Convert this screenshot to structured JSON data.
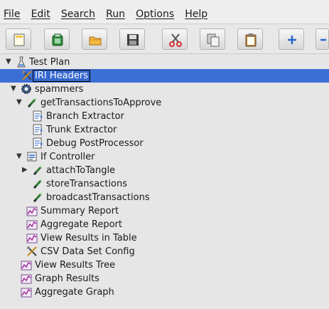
{
  "menu": [
    "File",
    "Edit",
    "Search",
    "Run",
    "Options",
    "Help"
  ],
  "toolbar": {
    "buttons": [
      {
        "name": "new-plan-button",
        "icon": "new-document-icon"
      },
      {
        "name": "templates-button",
        "icon": "templates-icon"
      },
      {
        "name": "open-button",
        "icon": "folder-icon"
      },
      {
        "name": "save-button",
        "icon": "floppy-disk-icon"
      },
      {
        "name": "cut-button",
        "icon": "scissors-icon"
      },
      {
        "name": "copy-button",
        "icon": "copy-icon"
      },
      {
        "name": "paste-button",
        "icon": "clipboard-icon"
      },
      {
        "name": "expand-button",
        "icon": "plus-icon"
      },
      {
        "name": "collapse-button",
        "icon": "minus-icon"
      }
    ]
  },
  "tree": {
    "nodes": [
      {
        "label": "Test Plan",
        "icon": "testplan-icon",
        "toggle": "expanded"
      },
      {
        "label": "IRI Headers",
        "icon": "config-icon",
        "toggle": "",
        "selected": true
      },
      {
        "label": "spammers",
        "icon": "gear-icon",
        "toggle": "expanded"
      },
      {
        "label": "getTransactionsToApprove",
        "icon": "sampler-icon",
        "toggle": "expanded"
      },
      {
        "label": "Branch Extractor",
        "icon": "extractor-icon",
        "toggle": ""
      },
      {
        "label": "Trunk Extractor",
        "icon": "extractor-icon",
        "toggle": ""
      },
      {
        "label": "Debug PostProcessor",
        "icon": "extractor-icon",
        "toggle": ""
      },
      {
        "label": "If Controller",
        "icon": "controller-icon",
        "toggle": "expanded"
      },
      {
        "label": "attachToTangle",
        "icon": "sampler-icon",
        "toggle": "collapsed"
      },
      {
        "label": "storeTransactions",
        "icon": "sampler-icon",
        "toggle": ""
      },
      {
        "label": "broadcastTransactions",
        "icon": "sampler-icon",
        "toggle": ""
      },
      {
        "label": "Summary Report",
        "icon": "listener-icon",
        "toggle": ""
      },
      {
        "label": "Aggregate Report",
        "icon": "listener-icon",
        "toggle": ""
      },
      {
        "label": "View Results in Table",
        "icon": "listener-icon",
        "toggle": ""
      },
      {
        "label": "CSV Data Set Config",
        "icon": "config-icon",
        "toggle": ""
      },
      {
        "label": "View Results Tree",
        "icon": "listener-icon",
        "toggle": ""
      },
      {
        "label": "Graph Results",
        "icon": "listener-icon",
        "toggle": ""
      },
      {
        "label": "Aggregate Graph",
        "icon": "listener-icon",
        "toggle": ""
      }
    ]
  }
}
